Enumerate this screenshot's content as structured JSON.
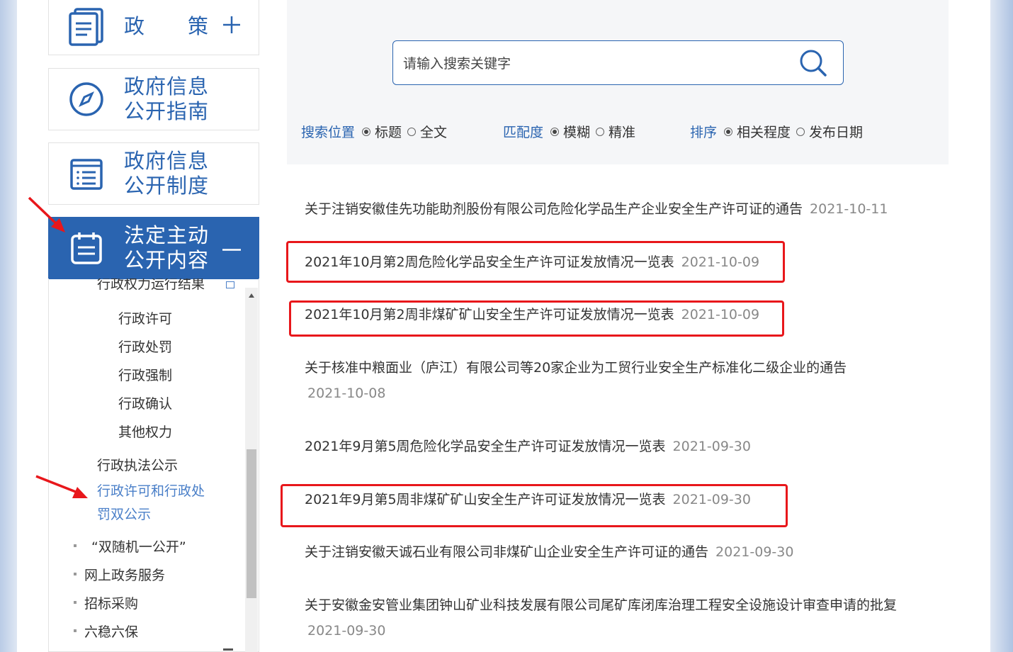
{
  "sidebar": {
    "menu": [
      {
        "label": "政　　策",
        "icon": "document-stack-icon",
        "toggle": "+"
      },
      {
        "label": "政府信息\n公开指南",
        "icon": "compass-icon"
      },
      {
        "label": "政府信息\n公开制度",
        "icon": "list-doc-icon"
      },
      {
        "label": "法定主动\n公开内容",
        "icon": "calendar-clipboard-icon",
        "toggle": "—",
        "active": true
      }
    ],
    "submenu": {
      "cut_item": "行政权力运行结果",
      "items": [
        "行政许可",
        "行政处罚",
        "行政强制",
        "行政确认",
        "其他权力"
      ],
      "level2": [
        "行政执法公示",
        "行政许可和行政处罚双公示"
      ],
      "active_index": 1,
      "level1": [
        "“双随机一公开”",
        "网上政务服务",
        "招标采购",
        "六稳六保"
      ]
    }
  },
  "search": {
    "placeholder": "请输入搜索关键字",
    "position_label": "搜索位置",
    "position_options": [
      "标题",
      "全文"
    ],
    "position_selected": "标题",
    "match_label": "匹配度",
    "match_options": [
      "模糊",
      "精准"
    ],
    "match_selected": "模糊",
    "sort_label": "排序",
    "sort_options": [
      "相关程度",
      "发布日期"
    ],
    "sort_selected": "相关程度"
  },
  "results": [
    {
      "title": "关于注销安徽佳先功能助剂股份有限公司危险化学品生产企业安全生产许可证的通告",
      "date": "2021-10-11",
      "highlighted": false
    },
    {
      "title": "2021年10月第2周危险化学品安全生产许可证发放情况一览表",
      "date": "2021-10-09",
      "highlighted": true
    },
    {
      "title": "2021年10月第2周非煤矿矿山安全生产许可证发放情况一览表",
      "date": "2021-10-09",
      "highlighted": true
    },
    {
      "title": "关于核准中粮面业（庐江）有限公司等20家企业为工贸行业安全生产标准化二级企业的通告",
      "date": "2021-10-08",
      "highlighted": false
    },
    {
      "title": "2021年9月第5周危险化学品安全生产许可证发放情况一览表",
      "date": "2021-09-30",
      "highlighted": false
    },
    {
      "title": "2021年9月第5周非煤矿矿山安全生产许可证发放情况一览表",
      "date": "2021-09-30",
      "highlighted": true
    },
    {
      "title": "关于注销安徽天诚石业有限公司非煤矿山企业安全生产许可证的通告",
      "date": "2021-09-30",
      "highlighted": false
    },
    {
      "title": "关于安徽金安管业集团钟山矿业科技发展有限公司尾矿库闭库治理工程安全设施设计审查申请的批复",
      "date": "2021-09-30",
      "highlighted": false
    }
  ],
  "colors": {
    "brand": "#2a64b0",
    "highlight": "#e8171b",
    "active_link": "#4a7fc8"
  }
}
